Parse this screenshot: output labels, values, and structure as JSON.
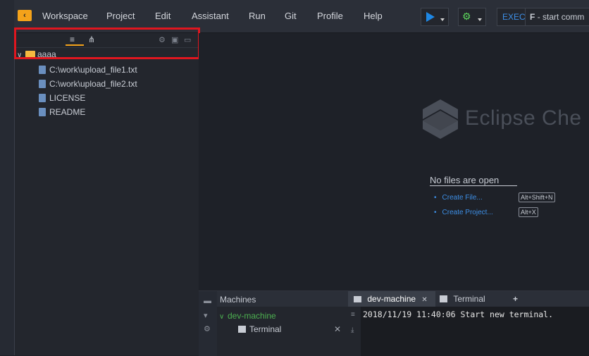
{
  "menu": {
    "items": [
      "Workspace",
      "Project",
      "Edit",
      "Assistant",
      "Run",
      "Git",
      "Profile",
      "Help"
    ],
    "exec_label": "EXEC",
    "exec_command": "- start comm",
    "exec_prefix": "F"
  },
  "explorer": {
    "project": "aaaa",
    "files": [
      "C:\\work\\upload_file1.txt",
      "C:\\work\\upload_file2.txt",
      "LICENSE",
      "README"
    ]
  },
  "editor": {
    "brand": "Eclipse Che",
    "no_files": "No files are open",
    "actions": [
      {
        "label": "Create File...",
        "shortcut": "Alt+Shift+N"
      },
      {
        "label": "Create Project...",
        "shortcut": "Alt+X"
      }
    ]
  },
  "bottom": {
    "machines_title": "Machines",
    "machine_name": "dev-machine",
    "machine_child": "Terminal",
    "tabs": [
      {
        "label": "dev-machine",
        "active": true
      },
      {
        "label": "Terminal",
        "active": false
      }
    ],
    "add_tab": "+",
    "terminal_line": "2018/11/19 11:40:06 Start new terminal."
  },
  "colors": {
    "accent": "#f4a21a",
    "link": "#3d8fe6",
    "machine_green": "#4caf50",
    "highlight": "#e0161f"
  }
}
